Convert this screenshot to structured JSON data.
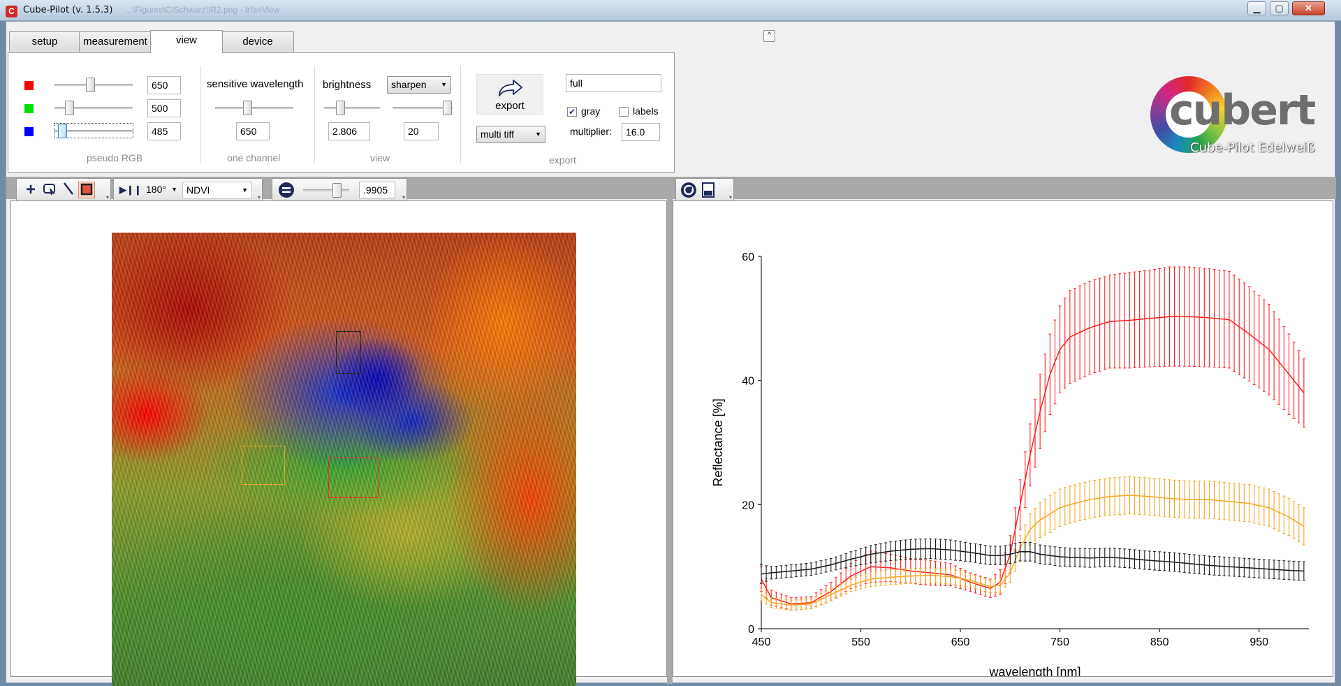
{
  "window": {
    "title": "Cube-Pilot (v. 1.5.3)",
    "ghost_title": "...\\Figures\\C\\Schwarz\\IR2.png - IrfanView",
    "min": "▁",
    "max": "▢",
    "close": "✕"
  },
  "tabs": [
    {
      "label": "setup",
      "active": false
    },
    {
      "label": "measurement",
      "active": false
    },
    {
      "label": "view",
      "active": true
    },
    {
      "label": "device",
      "active": false
    }
  ],
  "collapse": "^",
  "pseudo_rgb": {
    "caption": "pseudo RGB",
    "channels": [
      {
        "color": "#ff0000",
        "wavelength": "650",
        "level": 0.45
      },
      {
        "color": "#00e000",
        "wavelength": "500",
        "level": 0.15
      },
      {
        "color": "#0000ff",
        "wavelength": "485",
        "level": 0.05
      }
    ]
  },
  "one_channel": {
    "caption": "one channel",
    "label": "sensitive wavelength",
    "value": "650",
    "level": 0.4
  },
  "view_group": {
    "caption": "view",
    "brightness_label": "brightness",
    "brightness_value": "2.806",
    "brightness_level": 0.25,
    "filter_selected": "sharpen",
    "filter_value": "20",
    "filter_level": 0.98
  },
  "export_group": {
    "caption": "export",
    "button_label": "export",
    "format_selected": "multi tiff",
    "name_value": "full",
    "gray_label": "gray",
    "gray_checked": true,
    "labels_label": "labels",
    "labels_checked": false,
    "multiplier_label": "multiplier:",
    "multiplier_value": "16.0"
  },
  "logo": {
    "word": "cubert",
    "subtitle": "Cube-Pilot Edelweiß"
  },
  "image_toolbar": {
    "rotation": "180°",
    "mode": "NDVI",
    "threshold": ".9905",
    "threshold_level": 0.8
  },
  "colors": {
    "roi_black": "#1a1a1a",
    "roi_orange": "#f5a623",
    "roi_red": "#ff2020"
  },
  "chart_data": {
    "type": "line",
    "title": "",
    "xlabel": "wavelength [nm]",
    "ylabel": "Reflectance [%]",
    "xlim": [
      450,
      1000
    ],
    "ylim": [
      0,
      60
    ],
    "xticks": [
      450,
      550,
      650,
      750,
      850,
      950
    ],
    "yticks": [
      0,
      20,
      40,
      60
    ],
    "grid": false,
    "error_bars": true,
    "series": [
      {
        "color": "#ff2020",
        "x": [
          450,
          460,
          480,
          500,
          520,
          540,
          560,
          580,
          600,
          620,
          640,
          660,
          680,
          690,
          700,
          710,
          720,
          730,
          740,
          750,
          760,
          780,
          800,
          820,
          840,
          860,
          880,
          900,
          920,
          940,
          960,
          980,
          995
        ],
        "y": [
          8.0,
          5.0,
          4.0,
          4.2,
          6.0,
          8.5,
          10.0,
          9.8,
          9.3,
          9.0,
          8.7,
          7.5,
          6.5,
          7.5,
          12,
          20,
          28,
          35,
          41,
          45,
          47,
          48.5,
          49.5,
          49.7,
          50.0,
          50.3,
          50.3,
          50.1,
          49.8,
          47.5,
          45,
          41,
          38
        ],
        "err": [
          2,
          1.2,
          1,
          1,
          1.5,
          2,
          2.5,
          2.2,
          2,
          2,
          1.8,
          1.5,
          1.5,
          2,
          3,
          4,
          5,
          6,
          6.5,
          7,
          7.5,
          7.5,
          7.5,
          7.7,
          7.8,
          8,
          8,
          7.9,
          7.8,
          7.6,
          7.3,
          6.5,
          5.5
        ]
      },
      {
        "color": "#f5a623",
        "x": [
          450,
          460,
          480,
          500,
          520,
          540,
          560,
          580,
          600,
          620,
          640,
          660,
          680,
          690,
          700,
          710,
          720,
          730,
          740,
          750,
          760,
          780,
          800,
          820,
          840,
          860,
          880,
          900,
          920,
          940,
          960,
          980,
          995
        ],
        "y": [
          5.5,
          4.2,
          3.8,
          4.0,
          5.5,
          7.0,
          8.0,
          8.3,
          8.5,
          8.6,
          8.4,
          7.8,
          6.8,
          7.0,
          9.0,
          13,
          16,
          17.5,
          18.5,
          19.5,
          20.0,
          20.8,
          21.3,
          21.5,
          21.3,
          21.0,
          20.8,
          20.8,
          20.5,
          20.2,
          19.5,
          18.0,
          16.5
        ],
        "err": [
          1,
          0.8,
          0.8,
          0.8,
          1,
          1,
          1.2,
          1.2,
          1.2,
          1.2,
          1.2,
          1.1,
          1,
          1.2,
          1.5,
          2,
          2.5,
          2.8,
          3,
          3,
          3,
          3,
          3,
          3,
          3,
          3,
          3,
          3,
          3,
          3,
          3,
          3,
          3
        ]
      },
      {
        "color": "#1a1a1a",
        "x": [
          450,
          460,
          480,
          500,
          520,
          540,
          560,
          580,
          600,
          620,
          640,
          660,
          680,
          690,
          700,
          710,
          720,
          730,
          740,
          750,
          760,
          780,
          800,
          820,
          840,
          860,
          880,
          900,
          920,
          940,
          960,
          980,
          995
        ],
        "y": [
          8.8,
          9.0,
          9.3,
          9.6,
          10.3,
          11.2,
          12.0,
          12.5,
          12.8,
          12.9,
          12.7,
          12.3,
          11.8,
          11.8,
          12.0,
          12.4,
          12.4,
          12.0,
          11.8,
          11.6,
          11.5,
          11.4,
          11.5,
          11.3,
          11.0,
          10.8,
          10.5,
          10.2,
          10.0,
          9.8,
          9.6,
          9.4,
          9.3
        ],
        "err": [
          1.5,
          1,
          1,
          1,
          1,
          1.2,
          1.4,
          1.5,
          1.6,
          1.6,
          1.6,
          1.5,
          1.5,
          1.5,
          1.5,
          1.5,
          1.5,
          1.5,
          1.5,
          1.5,
          1.5,
          1.5,
          1.5,
          1.5,
          1.5,
          1.5,
          1.5,
          1.5,
          1.5,
          1.5,
          1.5,
          1.5,
          1.5
        ]
      }
    ]
  }
}
